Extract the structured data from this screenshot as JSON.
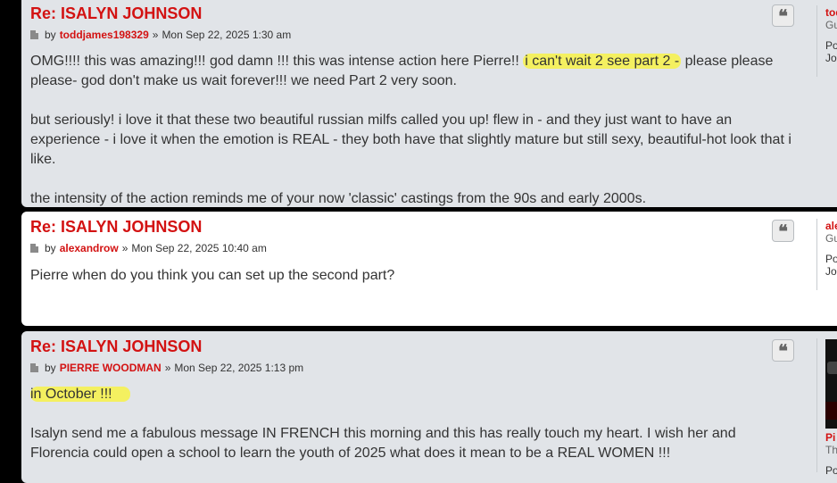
{
  "posts": [
    {
      "title": "Re: ISALYN JOHNSON",
      "by": "by",
      "author": "toddjames198329",
      "sep": "»",
      "date": "Mon Sep 22, 2025 1:30 am",
      "p1_a": "OMG!!!! this was amazing!!! god damn !!! this was intense action here Pierre!!",
      "p1_hl": "i can't wait 2 see part 2 -",
      "p1_b": " please please please- god don't make us wait forever!!! we need Part 2 very soon.",
      "p2": "but seriously! i love it that these two beautiful russian milfs called you up! flew in - and they just want to have an experience - i love it when the emotion is REAL - they both have that slightly mature but still sexy, beautiful-hot look that i like.",
      "p3": "the intensity of the action reminds me of your now 'classic' castings from the 90s and early 2000s.",
      "profile": {
        "name": "tod",
        "rank": "Gu",
        "stat1": "Po",
        "stat2": "Jo"
      }
    },
    {
      "title": "Re: ISALYN JOHNSON",
      "by": "by",
      "author": "alexandrow",
      "sep": "»",
      "date": "Mon Sep 22, 2025 10:40 am",
      "p1": "Pierre when do you think you can set up the second part?",
      "profile": {
        "name": "ale",
        "rank": "Gu",
        "stat1": "Po",
        "stat2": "Jo"
      }
    },
    {
      "title": "Re: ISALYN JOHNSON",
      "by": "by",
      "author": "PIERRE WOODMAN",
      "sep": "»",
      "date": "Mon Sep 22, 2025 1:13 pm",
      "p1_hl": "in October !!!",
      "p2": "Isalyn send me a fabulous message IN FRENCH this morning and this has really touch my heart. I wish her and Florencia could open a school to learn the youth of 2025 what does it mean to be a REAL WOMEN !!!",
      "profile": {
        "name": "Pi",
        "rank": "Th",
        "stat1": "Po"
      }
    }
  ],
  "icons": {
    "quote": "quote-icon",
    "post": "post-file-icon"
  },
  "colors": {
    "accent": "#d31212",
    "highlight": "#f4f060",
    "post_bg_odd": "#e1e4e8",
    "post_bg_even": "#ffffff"
  }
}
